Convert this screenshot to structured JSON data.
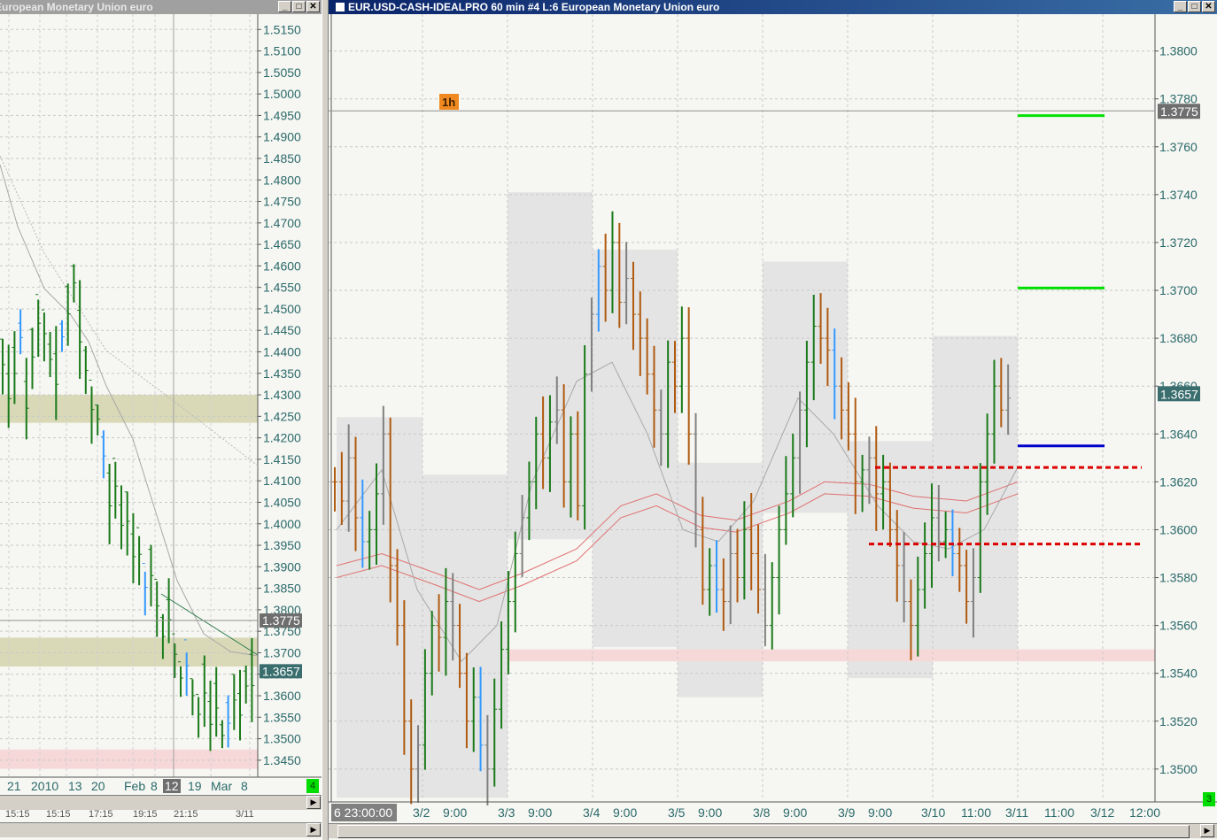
{
  "left_window": {
    "title": "European Monetary Union euro",
    "price_labels": [
      "1.5150",
      "1.5100",
      "1.5050",
      "1.5000",
      "1.4950",
      "1.4900",
      "1.4850",
      "1.4800",
      "1.4750",
      "1.4700",
      "1.4650",
      "1.4600",
      "1.4550",
      "1.4500",
      "1.4450",
      "1.4400",
      "1.4350",
      "1.4300",
      "1.4250",
      "1.4200",
      "1.4150",
      "1.4100",
      "1.4050",
      "1.4000",
      "1.3950",
      "1.3900",
      "1.3850",
      "1.3800",
      "1.3750",
      "1.3700",
      "1.3650",
      "1.3600",
      "1.3550",
      "1.3500",
      "1.3450"
    ],
    "price_marker_gray": "1.3775",
    "price_marker_current": "1.3657",
    "x_labels": [
      "21",
      "2010",
      "13",
      "20",
      "Feb",
      "8",
      "12",
      "19",
      "Mar",
      "8"
    ],
    "x_highlight": "12",
    "bottom_times": [
      "15:15",
      "15:15",
      "17:15",
      "19:15",
      "21:15",
      "3/11"
    ],
    "badge": "4"
  },
  "right_window": {
    "title": "EUR.USD-CASH-IDEALPRO  60 min   #4  L:6  European Monetary Union euro",
    "timeframe_badge": "1h",
    "price_labels": [
      "1.3800",
      "1.3780",
      "1.3760",
      "1.3740",
      "1.3720",
      "1.3700",
      "1.3680",
      "1.3660",
      "1.3640",
      "1.3620",
      "1.3600",
      "1.3580",
      "1.3560",
      "1.3540",
      "1.3520",
      "1.3500"
    ],
    "price_marker_gray": "1.3775",
    "price_marker_current": "1.3657",
    "x_first_label": "6  23:00:00",
    "x_labels": [
      "3/2",
      "9:00",
      "3/3",
      "9:00",
      "3/4",
      "9:00",
      "3/5",
      "9:00",
      "3/8",
      "9:00",
      "3/9",
      "9:00",
      "3/10",
      "11:00",
      "3/11",
      "11:00",
      "3/12",
      "12:00"
    ],
    "badge": "3"
  },
  "colors": {
    "bar_up": "#1a7a1a",
    "bar_down": "#b05a10",
    "bar_neutral": "#808080",
    "bar_blue": "#3399ff",
    "level_green": "#00e000",
    "level_blue": "#0000cc",
    "level_red": "#dd0000",
    "zone_gray": "#e4e4e4",
    "zone_pink": "#f7d8d8",
    "zone_olive": "#d9d9b8",
    "axis_text": "#2a6a6a",
    "marker_current_bg": "#3a6e6e",
    "marker_gray_bg": "#6e6e6e"
  },
  "chart_data": [
    {
      "type": "bar",
      "series_kind": "ohlc",
      "ylim": [
        1.3425,
        1.5165
      ],
      "levels": [
        1.3775,
        1.3657
      ],
      "zones": [
        {
          "from": 1.4235,
          "to": 1.43
        },
        {
          "from": 1.3668,
          "to": 1.3735
        },
        {
          "from": 1.343,
          "to": 1.3475
        }
      ]
    },
    {
      "type": "bar",
      "series_kind": "ohlc",
      "ylim": [
        1.3487,
        1.3808
      ],
      "levels": [
        1.3775,
        1.3657
      ],
      "horizontal_lines": [
        {
          "value": 1.3773,
          "color": "green"
        },
        {
          "value": 1.3701,
          "color": "green"
        },
        {
          "value": 1.3635,
          "color": "blue"
        },
        {
          "value": 1.3626,
          "color": "red",
          "dashed": true
        },
        {
          "value": 1.3594,
          "color": "red",
          "dashed": true
        }
      ],
      "pink_zone": [
        1.3545,
        1.355
      ]
    }
  ]
}
